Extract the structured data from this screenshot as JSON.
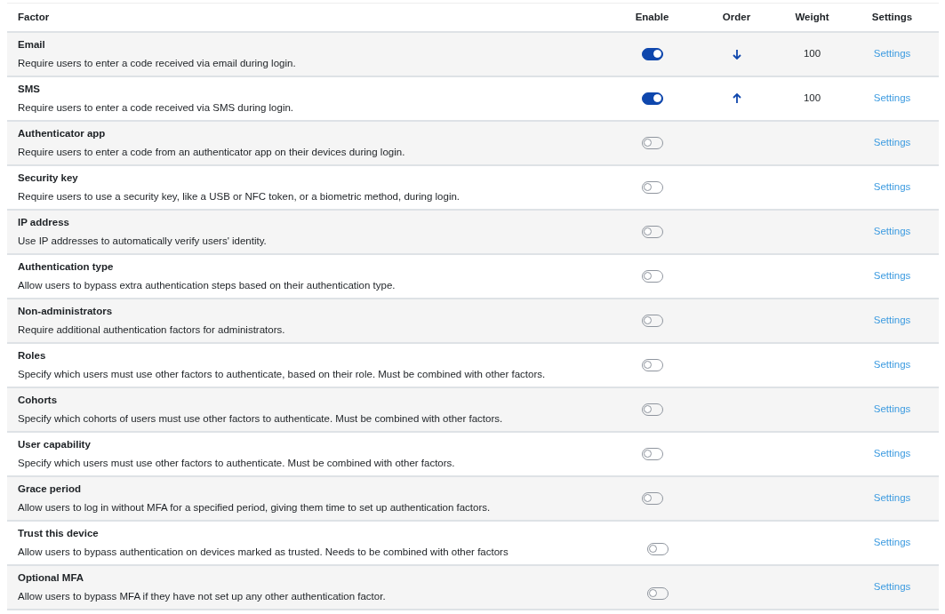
{
  "table": {
    "columns": [
      "Factor",
      "Enable",
      "Order",
      "Weight",
      "Settings"
    ],
    "rows": [
      {
        "name": "Email",
        "description": "Require users to enter a code received via email during login.",
        "enabled": true,
        "order": {
          "kind": "down"
        },
        "weight": "100",
        "link": "Settings"
      },
      {
        "name": "SMS",
        "description": "Require users to enter a code received via SMS during login.",
        "enabled": true,
        "order": {
          "kind": "up"
        },
        "weight": "100",
        "link": "Settings"
      },
      {
        "name": "Authenticator app",
        "description": "Require users to enter a code from an authenticator app on their devices during login.",
        "enabled": false,
        "link": "Settings"
      },
      {
        "name": "Security key",
        "description": "Require users to use a security key, like a USB or NFC token, or a biometric method, during login.",
        "enabled": false,
        "link": "Settings"
      },
      {
        "name": "IP address",
        "description": "Use IP addresses to automatically verify users' identity.",
        "enabled": false,
        "link": "Settings"
      },
      {
        "name": "Authentication type",
        "description": "Allow users to bypass extra authentication steps based on their authentication type.",
        "enabled": false,
        "link": "Settings"
      },
      {
        "name": "Non-administrators",
        "description": "Require additional authentication factors for administrators.",
        "enabled": false,
        "link": "Settings"
      },
      {
        "name": "Roles",
        "description": "Specify which users must use other factors to authenticate, based on their role. Must be combined with other factors.",
        "enabled": false,
        "link": "Settings"
      },
      {
        "name": "Cohorts",
        "description": "Specify which cohorts of users must use other factors to authenticate. Must be combined with other factors.",
        "enabled": false,
        "link": "Settings"
      },
      {
        "name": "User capability",
        "description": "Specify which users must use other factors to authenticate. Must be combined with other factors.",
        "enabled": false,
        "link": "Settings"
      },
      {
        "name": "Grace period",
        "description": "Allow users to log in without MFA for a specified period, giving them time to set up authentication factors.",
        "enabled": false,
        "link": "Settings"
      },
      {
        "name": "Trust this device",
        "description": "Allow users to bypass authentication on devices marked as trusted. Needs to be combined with other factors",
        "enabled": false,
        "link": "Settings"
      },
      {
        "name": "Optional MFA",
        "description": "Allow users to bypass MFA if they have not set up any other authentication factor.",
        "enabled": false,
        "link": "Settings"
      }
    ]
  }
}
